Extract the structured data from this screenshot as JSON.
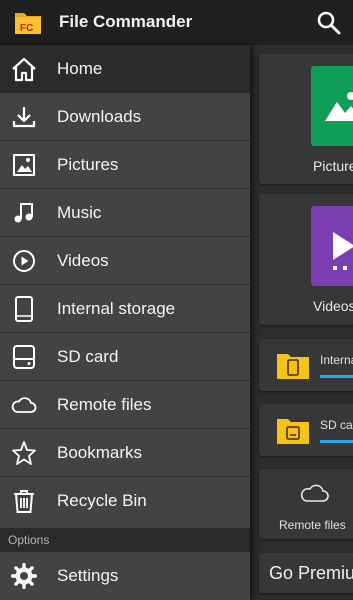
{
  "app": {
    "title": "File Commander",
    "logo_text": "FC",
    "search_icon": "search-icon"
  },
  "drawer": {
    "items": [
      {
        "label": "Home",
        "icon": "home-icon",
        "active": true
      },
      {
        "label": "Downloads",
        "icon": "download-icon"
      },
      {
        "label": "Pictures",
        "icon": "image-icon"
      },
      {
        "label": "Music",
        "icon": "music-note-icon"
      },
      {
        "label": "Videos",
        "icon": "play-circle-icon"
      },
      {
        "label": "Internal storage",
        "icon": "phone-icon"
      },
      {
        "label": "SD card",
        "icon": "sd-card-icon"
      },
      {
        "label": "Remote files",
        "icon": "cloud-icon"
      },
      {
        "label": "Bookmarks",
        "icon": "star-icon"
      },
      {
        "label": "Recycle Bin",
        "icon": "trash-icon"
      }
    ],
    "options_header": "Options",
    "options_items": [
      {
        "label": "Settings",
        "icon": "gear-icon"
      }
    ]
  },
  "main": {
    "pictures_label": "Pictures",
    "videos_label": "Videos",
    "internal_label": "Internal storage",
    "sdcard_label": "SD card",
    "remote_label": "Remote files",
    "premium_label": "Go Premium"
  },
  "colors": {
    "pictures_tile": "#0f9d58",
    "videos_tile": "#7b3fb3",
    "folder": "#f5c219",
    "storage_bar": "#29a9e0"
  }
}
